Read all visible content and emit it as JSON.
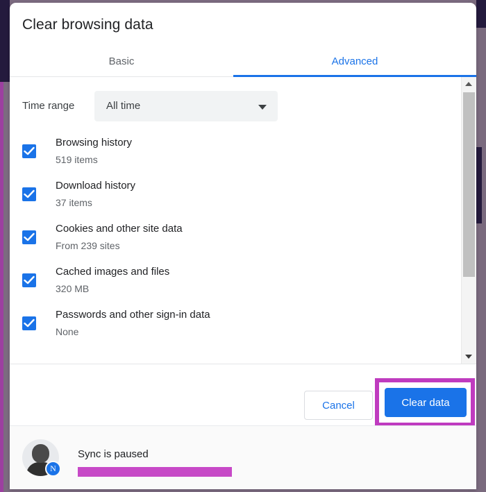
{
  "dialog": {
    "title": "Clear browsing data"
  },
  "tabs": [
    {
      "label": "Basic",
      "active": false
    },
    {
      "label": "Advanced",
      "active": true
    }
  ],
  "time_range": {
    "label": "Time range",
    "value": "All time",
    "caret_icon": "chevron-down-icon"
  },
  "options": [
    {
      "title": "Browsing history",
      "subtitle": "519 items",
      "checked": true
    },
    {
      "title": "Download history",
      "subtitle": "37 items",
      "checked": true
    },
    {
      "title": "Cookies and other site data",
      "subtitle": "From 239 sites",
      "checked": true
    },
    {
      "title": "Cached images and files",
      "subtitle": "320 MB",
      "checked": true
    },
    {
      "title": "Passwords and other sign-in data",
      "subtitle": "None",
      "checked": true
    }
  ],
  "scrollbar": {
    "up_arrow_icon": "caret-up-icon",
    "down_arrow_icon": "caret-down-icon"
  },
  "footer": {
    "cancel_label": "Cancel",
    "clear_label": "Clear data"
  },
  "sync": {
    "status": "Sync is paused",
    "email": "",
    "badge_icon": "sync-paused-icon"
  },
  "colors": {
    "accent_blue": "#1a73e8",
    "highlight_magenta": "#bf3bbf",
    "redaction_magenta": "#c23ac2",
    "text_primary": "#202124",
    "text_secondary": "#5f6368",
    "select_bg": "#f1f3f4"
  }
}
